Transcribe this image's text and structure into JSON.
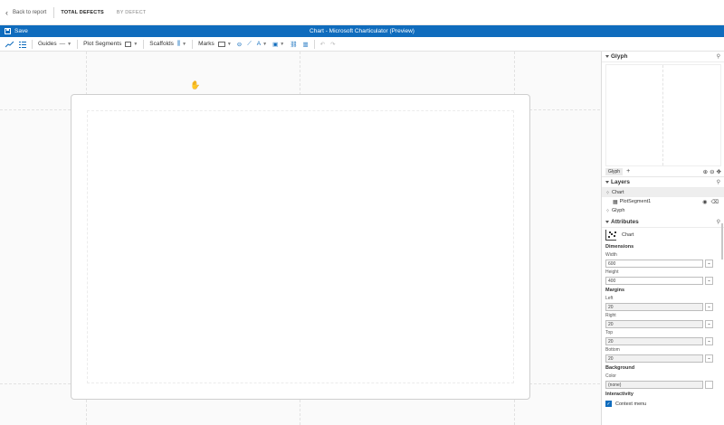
{
  "topnav": {
    "back_label": "Back to report",
    "tabs": [
      {
        "label": "TOTAL DEFECTS",
        "active": true
      },
      {
        "label": "BY DEFECT",
        "active": false
      }
    ]
  },
  "titlebar": {
    "save_label": "Save",
    "app_title": "Chart - Microsoft Charticulator (Preview)",
    "accent": "#0f6cbd"
  },
  "toolbar": {
    "guides_label": "Guides",
    "plot_segments_label": "Plot Segments",
    "scaffolds_label": "Scaffolds",
    "marks_label": "Marks",
    "text_icon_glyph": "A"
  },
  "panel": {
    "glyph": {
      "title": "Glyph",
      "tab_label": "Glyph"
    },
    "layers": {
      "title": "Layers",
      "items": [
        {
          "label": "Chart"
        },
        {
          "label": "PlotSegment1"
        },
        {
          "label": "Glyph"
        }
      ]
    },
    "attributes": {
      "title": "Attributes",
      "object_label": "Chart",
      "dimensions_label": "Dimensions",
      "width_label": "Width",
      "width_value": "600",
      "height_label": "Height",
      "height_value": "400",
      "margins_label": "Margins",
      "left_label": "Left",
      "left_value": "20",
      "right_label": "Right",
      "right_value": "20",
      "top_label": "Top",
      "top_value": "20",
      "bottom_label": "Bottom",
      "bottom_value": "20",
      "background_label": "Background",
      "color_label": "Color",
      "color_value": "(none)",
      "interactivity_label": "Interactivity",
      "context_menu_label": "Context menu"
    }
  }
}
